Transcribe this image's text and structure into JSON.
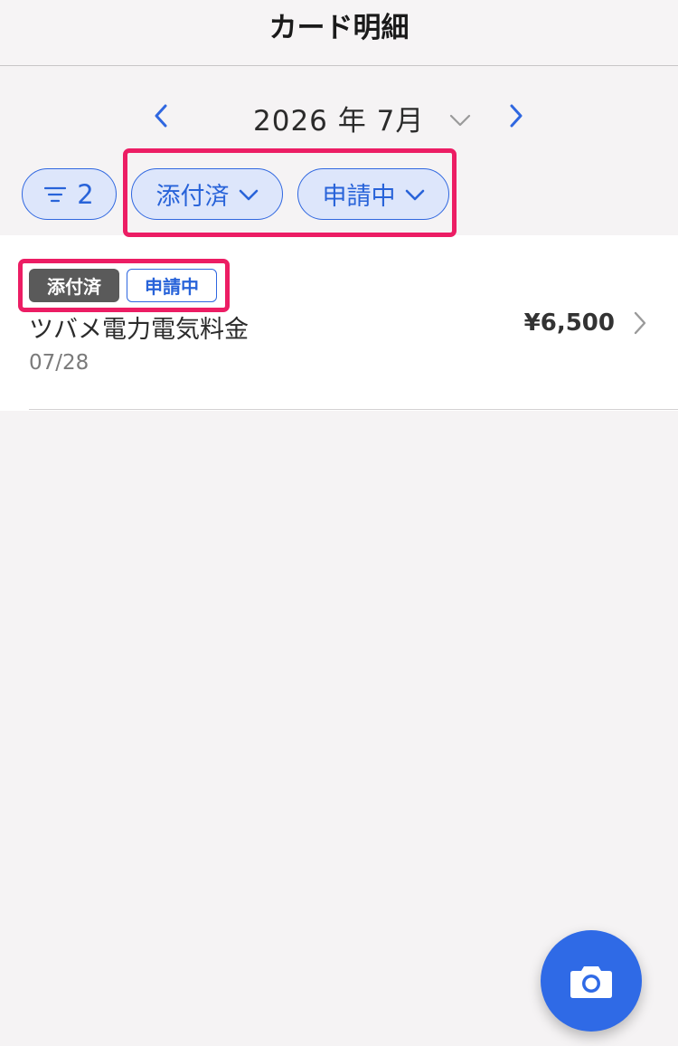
{
  "header": {
    "title": "カード明細"
  },
  "month_nav": {
    "month_label": "2026 年 7月"
  },
  "filters": {
    "filter_count": "2",
    "attachment_filter_label": "添付済",
    "status_filter_label": "申請中"
  },
  "transactions": [
    {
      "tags": [
        "添付済",
        "申請中"
      ],
      "title": "ツバメ電力電気料金",
      "date": "07/28",
      "amount": "¥6,500"
    }
  ],
  "colors": {
    "accent": "#2f67e0",
    "highlight": "#ec1d64",
    "chip_bg": "#dde6fb",
    "tag_dark": "#5a5a5a"
  },
  "icons": {
    "prev": "chevron-left-icon",
    "next": "chevron-right-icon",
    "dropdown": "chevron-down-icon",
    "filter": "filter-lines-icon",
    "row": "chevron-right-icon",
    "fab": "camera-icon"
  }
}
